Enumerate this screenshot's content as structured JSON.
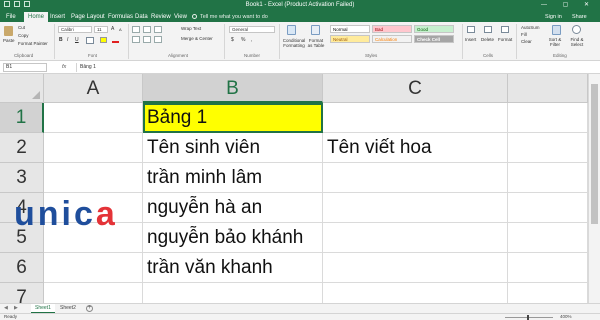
{
  "window": {
    "title": "Book1 - Excel (Product Activation Failed)",
    "controls": "— ▢ ✕"
  },
  "tabs": [
    "File",
    "Home",
    "Insert",
    "Page Layout",
    "Formulas",
    "Data",
    "Review",
    "View"
  ],
  "active_tab": "Home",
  "tell_me": "Tell me what you want to do",
  "account": {
    "sign_in": "Sign in",
    "share": "Share"
  },
  "ribbon": {
    "clipboard": {
      "paste": "Paste",
      "cut": "Cut",
      "copy": "Copy",
      "format_painter": "Format Painter",
      "label": "Clipboard"
    },
    "font": {
      "name": "Calibri",
      "size": "11",
      "bold": "B",
      "italic": "I",
      "underline": "U",
      "grow": "A",
      "shrink": "A",
      "label": "Font"
    },
    "alignment": {
      "wrap_text": "Wrap Text",
      "merge_center": "Merge & Center",
      "label": "Alignment"
    },
    "number": {
      "format": "General",
      "currency": "$",
      "percent": "%",
      "comma": ",",
      "label": "Number"
    },
    "styles": {
      "conditional_formatting": "Conditional Formatting",
      "format_as_table": "Format as Table",
      "normal": "Normal",
      "bad": "Bad",
      "good": "Good",
      "neutral": "Neutral",
      "calculation": "Calculation",
      "check_cell": "Check Cell",
      "label": "Styles"
    },
    "cells": {
      "insert": "Insert",
      "delete": "Delete",
      "format": "Format",
      "label": "Cells"
    },
    "editing": {
      "autosum": "AutoSum",
      "fill": "Fill",
      "clear": "Clear",
      "sort_filter": "Sort & Filter",
      "find_select": "Find & Select",
      "label": "Editing"
    }
  },
  "formula_bar": {
    "name_box": "B1",
    "fx": "fx",
    "value": "Bảng 1"
  },
  "sheet": {
    "columns": [
      "A",
      "B",
      "C"
    ],
    "selected_column": "B",
    "selected_row": "1",
    "rows": [
      {
        "num": "1",
        "A": "",
        "B": "Bảng 1",
        "C": ""
      },
      {
        "num": "2",
        "A": "",
        "B": "Tên sinh viên",
        "C": "Tên viết hoa"
      },
      {
        "num": "3",
        "A": "",
        "B": "trần minh lâm",
        "C": ""
      },
      {
        "num": "4",
        "A": "",
        "B": "nguyễn hà an",
        "C": ""
      },
      {
        "num": "5",
        "A": "",
        "B": "nguyễn bảo khánh",
        "C": ""
      },
      {
        "num": "6",
        "A": "",
        "B": "trần văn khanh",
        "C": ""
      },
      {
        "num": "7",
        "A": "",
        "B": "",
        "C": ""
      }
    ],
    "highlight_color": "#ffff00"
  },
  "sheet_tabs": [
    "Sheet1",
    "Sheet2"
  ],
  "active_sheet": "Sheet1",
  "status": {
    "ready": "Ready",
    "zoom": "400%"
  },
  "watermark": {
    "text": "unica"
  },
  "colors": {
    "excel_green": "#217346",
    "logo_blue": "#1f4e9c",
    "logo_red": "#e43338"
  }
}
